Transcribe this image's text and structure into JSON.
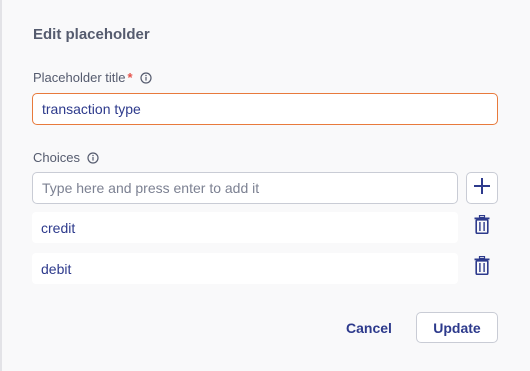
{
  "dialog": {
    "title": "Edit placeholder"
  },
  "placeholder_title": {
    "label": "Placeholder title",
    "required_mark": "*",
    "value": "transaction type"
  },
  "choices": {
    "label": "Choices",
    "input_placeholder": "Type here and press enter to add it",
    "items": [
      {
        "label": "credit"
      },
      {
        "label": "debit"
      }
    ]
  },
  "actions": {
    "cancel_label": "Cancel",
    "update_label": "Update"
  },
  "icons": {
    "info": "info-icon",
    "add": "plus-icon",
    "delete": "trash-icon"
  },
  "colors": {
    "accent_text": "#2d3a8c",
    "focus_border": "#e87a3c",
    "required": "#e5534b",
    "label": "#555b6e"
  }
}
